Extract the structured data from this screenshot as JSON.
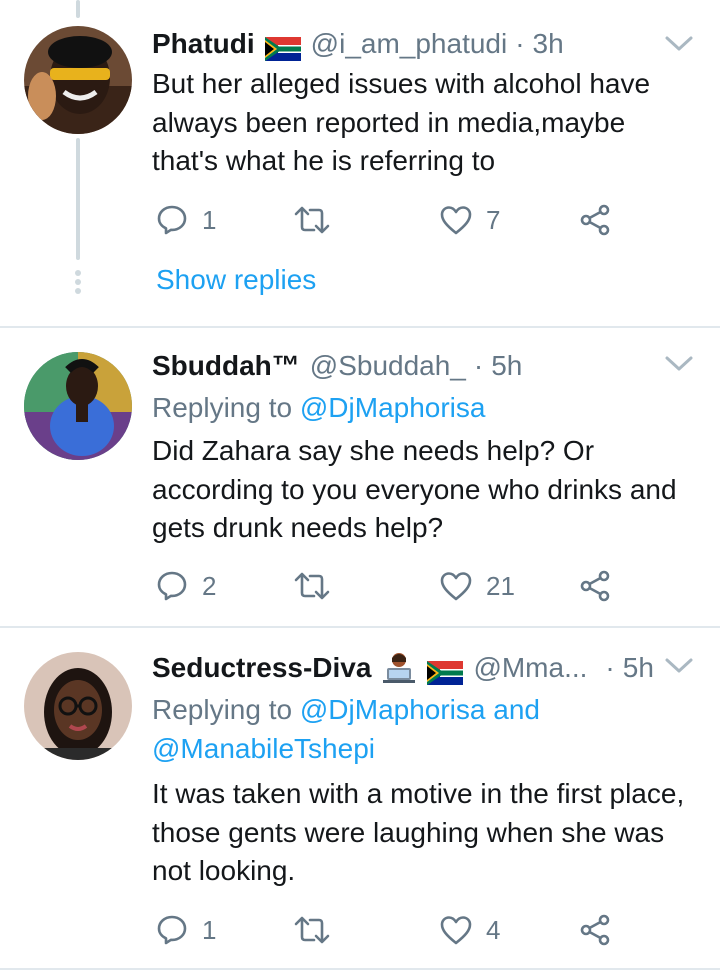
{
  "tweets": [
    {
      "display_name": "Phatudi",
      "flag": "south-africa-flag",
      "handle": "@i_am_phatudi",
      "separator": "·",
      "time": "3h",
      "text": "But her alleged issues with alcohol have always been reported in media,maybe that's what he is referring to",
      "replies": "1",
      "retweets": "",
      "likes": "7",
      "show_replies": "Show replies"
    },
    {
      "display_name": "Sbuddah™",
      "handle": "@Sbuddah_",
      "separator": "·",
      "time": "5h",
      "replying_prefix": "Replying to ",
      "replying_to": "@DjMaphorisa",
      "text": "Did Zahara say she needs help? Or according to you everyone who drinks and gets drunk needs help?",
      "replies": "2",
      "retweets": "",
      "likes": "21"
    },
    {
      "display_name": "Seductress-Diva",
      "emoji": "woman-technologist-emoji",
      "flag": "south-africa-flag",
      "handle": "@Mma...",
      "separator": "·",
      "time": "5h",
      "replying_prefix": "Replying to ",
      "replying_to": "@DjMaphorisa and",
      "replying_to_2": "@ManabileTshepi",
      "text": "It was taken with a motive in the first place, those gents were laughing when she was not looking.",
      "replies": "1",
      "retweets": "",
      "likes": "4"
    }
  ],
  "colors": {
    "link": "#1da1f2",
    "muted": "#657786",
    "divider": "#e1e8ed",
    "icon": "#657786"
  }
}
